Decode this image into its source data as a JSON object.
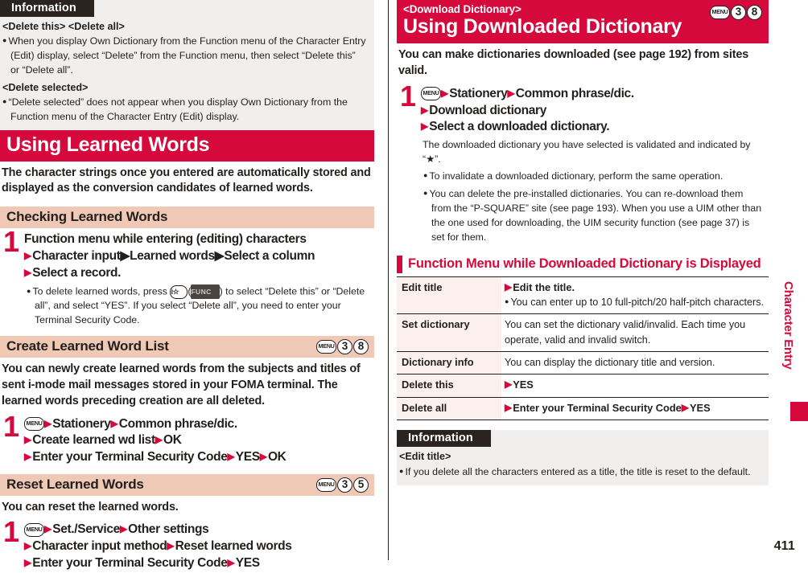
{
  "colors": {
    "brand_red": "#d6093c",
    "subhead_pink": "#efc8b6",
    "info_gray": "#f0efee",
    "table_key_pink": "#fbf0ed",
    "info_head_dark": "#2b2320"
  },
  "left": {
    "information": {
      "heading": "Information",
      "groups": [
        {
          "label": "<Delete this> <Delete all>",
          "items": [
            "When you display Own Dictionary from the Function menu of the Character Entry (Edit) display, select “Delete” from the Function menu, then select “Delete this” or “Delete all”."
          ]
        },
        {
          "label": "<Delete selected>",
          "items": [
            "“Delete selected” does not appear when you display Own Dictionary from the Function menu of the Character Entry (Edit) display."
          ]
        }
      ]
    },
    "banner": {
      "eyebrow": "",
      "title": "Using Learned Words",
      "keys": []
    },
    "lead": "The character strings once you entered are automatically stored and displayed as the conversion candidates of learned words.",
    "sections": [
      {
        "subhead": "Checking Learned Words",
        "keys": [],
        "step_number": "1",
        "lines": [
          {
            "tri": false,
            "text": "Function menu while entering (editing) characters"
          },
          {
            "tri": true,
            "text": "Character input▶Learned words▶Select a column"
          },
          {
            "tri": true,
            "text": "Select a record."
          }
        ],
        "note": "To delete learned words, press #IMODE#(#FUNC#) to select “Delete this” or “Delete all”, and select “YES”. If you select “Delete all”, you need to enter your Terminal Security Code.",
        "intro": ""
      },
      {
        "subhead": "Create Learned Word List",
        "keys": [
          "MENU",
          "3",
          "8"
        ],
        "intro": "You can newly create learned words from the subjects and titles of sent i-mode mail messages stored in your FOMA terminal. The learned words preceding creation are all deleted.",
        "step_number": "1",
        "lines": [
          {
            "tri": false,
            "menu_key": true,
            "text": "▶Stationery▶Common phrase/dic."
          },
          {
            "tri": true,
            "text": "Create learned wd list▶OK"
          },
          {
            "tri": true,
            "text": "Enter your Terminal Security Code▶YES▶OK"
          }
        ],
        "note": ""
      },
      {
        "subhead": "Reset Learned Words",
        "keys": [
          "MENU",
          "3",
          "5"
        ],
        "intro": "You can reset the learned words.",
        "step_number": "1",
        "lines": [
          {
            "tri": false,
            "menu_key": true,
            "text": "▶Set./Service▶Other settings"
          },
          {
            "tri": true,
            "text": "Character input method▶Reset learned words"
          },
          {
            "tri": true,
            "text": "Enter your Terminal Security Code▶YES"
          }
        ],
        "note": ""
      }
    ]
  },
  "right": {
    "banner": {
      "eyebrow": "<Download Dictionary>",
      "title": "Using Downloaded Dictionary",
      "keys": [
        "MENU",
        "3",
        "8"
      ]
    },
    "lead": "You can make dictionaries downloaded (see page 192) from sites valid.",
    "step_number": "1",
    "lines": [
      {
        "menu_key": true,
        "text": "▶Stationery▶Common phrase/dic."
      },
      {
        "tri": true,
        "text": "Download dictionary"
      },
      {
        "tri": true,
        "text": "Select a downloaded dictionary."
      }
    ],
    "subnote": "The downloaded dictionary you have selected is validated and indicated by “★”.",
    "notes": [
      "To invalidate a downloaded dictionary, perform the same operation.",
      "You can delete the pre-installed dictionaries. You can re-download them from the “P-SQUARE” site (see page 193). When you use a UIM other than the one used for downloading, the UIM security function (see page 37) is set for them."
    ],
    "function_menu": {
      "heading": "Function Menu while Downloaded Dictionary is Displayed",
      "rows": [
        {
          "key": "Edit title",
          "value_bold": "▶Edit the title.",
          "value_sub": "You can enter up to 10 full-pitch/20 half-pitch characters.",
          "value_plain": ""
        },
        {
          "key": "Set dictionary",
          "value_bold": "",
          "value_sub": "",
          "value_plain": "You can set the dictionary valid/invalid. Each time you operate, valid and invalid switch."
        },
        {
          "key": "Dictionary info",
          "value_bold": "",
          "value_sub": "",
          "value_plain": "You can display the dictionary title and version."
        },
        {
          "key": "Delete this",
          "value_bold": "▶YES",
          "value_sub": "",
          "value_plain": ""
        },
        {
          "key": "Delete all",
          "value_bold": "▶Enter your Terminal Security Code▶YES",
          "value_sub": "",
          "value_plain": ""
        }
      ]
    },
    "information": {
      "heading": "Information",
      "groups": [
        {
          "label": "<Edit title>",
          "items": [
            "If you delete all the characters entered as a title, the title is reset to the default."
          ]
        }
      ]
    }
  },
  "side_tab": "Character Entry",
  "page_number": "411"
}
